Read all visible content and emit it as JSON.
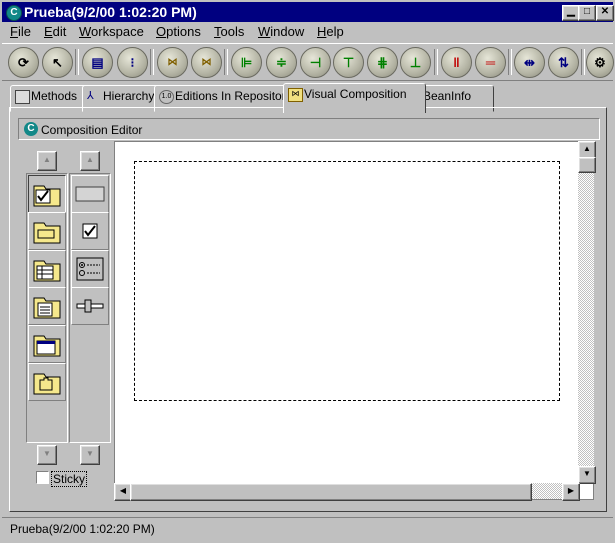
{
  "window": {
    "title": "Prueba(9/2/00 1:02:20 PM)",
    "icon_letter": "C"
  },
  "menubar": {
    "items": [
      {
        "label": "File",
        "mnemonic": "F"
      },
      {
        "label": "Edit",
        "mnemonic": "E"
      },
      {
        "label": "Workspace",
        "mnemonic": "W"
      },
      {
        "label": "Options",
        "mnemonic": "O"
      },
      {
        "label": "Tools",
        "mnemonic": "T"
      },
      {
        "label": "Window",
        "mnemonic": "W"
      },
      {
        "label": "Help",
        "mnemonic": "H"
      }
    ]
  },
  "toolbar": {
    "buttons": [
      "refresh-icon",
      "pointer-icon",
      "bean-list-icon",
      "bean-dots-icon",
      "run-icon",
      "connect-icon",
      "align-left-icon",
      "align-center-icon",
      "align-right-icon",
      "align-top-icon",
      "align-middle-icon",
      "align-bottom-icon",
      "match-width-icon",
      "match-height-icon",
      "distribute-horizontal-icon",
      "distribute-vertical-icon",
      "settings-icon"
    ]
  },
  "tabs": [
    {
      "label": "Methods",
      "icon": "methods-icon"
    },
    {
      "label": "Hierarchy",
      "icon": "hierarchy-icon"
    },
    {
      "label": "Editions In Repository",
      "icon": "editions-icon"
    },
    {
      "label": "Visual Composition",
      "icon": "visual-composition-icon",
      "active": true
    },
    {
      "label": "BeanInfo",
      "icon": "beaninfo-icon"
    }
  ],
  "composition_editor": {
    "title": "Composition Editor",
    "icon_letter": "C",
    "sticky_label": "Sticky",
    "sticky_checked": false
  },
  "palette": {
    "categories": [
      "swing-basic-folder-icon",
      "swing-panel-folder-icon",
      "swing-table-folder-icon",
      "swing-text-folder-icon",
      "swing-window-folder-icon",
      "swing-other-folder-icon"
    ],
    "components": [
      "jbutton-icon",
      "jcheckbox-icon",
      "jradiobutton-group-icon",
      "jslider-icon"
    ]
  },
  "statusbar": {
    "text": "Prueba(9/2/00 1:02:20 PM)"
  }
}
